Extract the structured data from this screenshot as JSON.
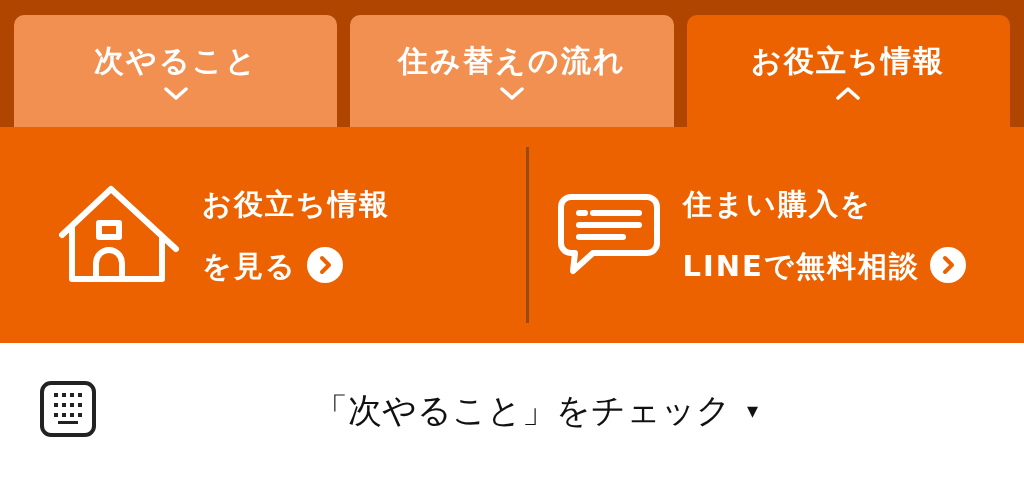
{
  "tabs": [
    {
      "label": "次やること",
      "selected": false
    },
    {
      "label": "住み替えの流れ",
      "selected": false
    },
    {
      "label": "お役立ち情報",
      "selected": true
    }
  ],
  "panel": {
    "items": [
      {
        "kind": "house",
        "lines": [
          "お役立ち情報",
          "を見る"
        ]
      },
      {
        "kind": "chat",
        "lines": [
          "住まい購入を",
          "LINEで無料相談"
        ]
      }
    ]
  },
  "footer": {
    "title": "「次やること」をチェック",
    "caret": "▾"
  }
}
